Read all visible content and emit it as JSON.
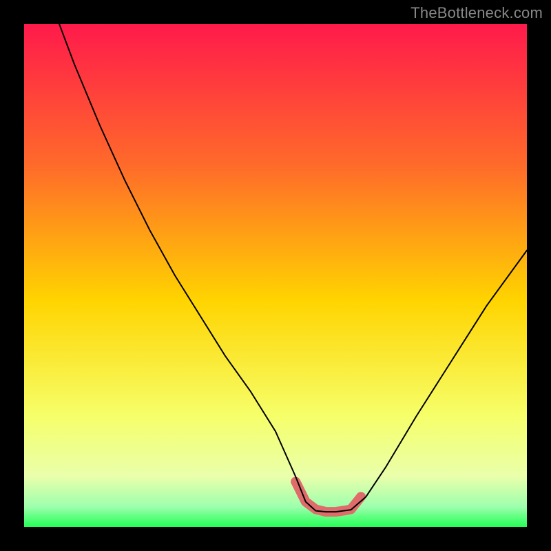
{
  "attribution": "TheBottleneck.com",
  "colors": {
    "frame": "#000000",
    "top": "#ff1a4b",
    "mid_upper": "#ff7a2a",
    "mid": "#ffd400",
    "mid_lower": "#f5ff66",
    "green": "#24ff56",
    "curve": "#000000",
    "pink": "#df6b6b"
  },
  "chart_data": {
    "type": "line",
    "title": "",
    "xlabel": "",
    "ylabel": "",
    "x_range": [
      0,
      100
    ],
    "y_range": [
      0,
      100
    ],
    "notes": "Bottleneck-style V curve over a vertical rainbow gradient; minimum (pink highlighted plateau) near x≈56–65, y≈3. Left branch rises to ~100 at x≈7; right branch rises to ~55 at x=100. No numeric axis labels are visible.",
    "series": [
      {
        "name": "bottleneck-curve",
        "x": [
          7,
          10,
          15,
          20,
          25,
          30,
          35,
          40,
          45,
          50,
          54,
          56,
          58,
          60,
          62,
          65,
          68,
          72,
          78,
          85,
          92,
          100
        ],
        "y": [
          100,
          92,
          80,
          69,
          59,
          50,
          42,
          34,
          27,
          19,
          10,
          5,
          3.2,
          3,
          3,
          3.4,
          6,
          12,
          22,
          33,
          44,
          55
        ]
      }
    ],
    "highlight": {
      "name": "trough-pink",
      "x": [
        54,
        56,
        58,
        60,
        62,
        64,
        65,
        67
      ],
      "y": [
        9,
        5,
        3.5,
        3,
        3,
        3.3,
        3.5,
        6
      ]
    }
  }
}
